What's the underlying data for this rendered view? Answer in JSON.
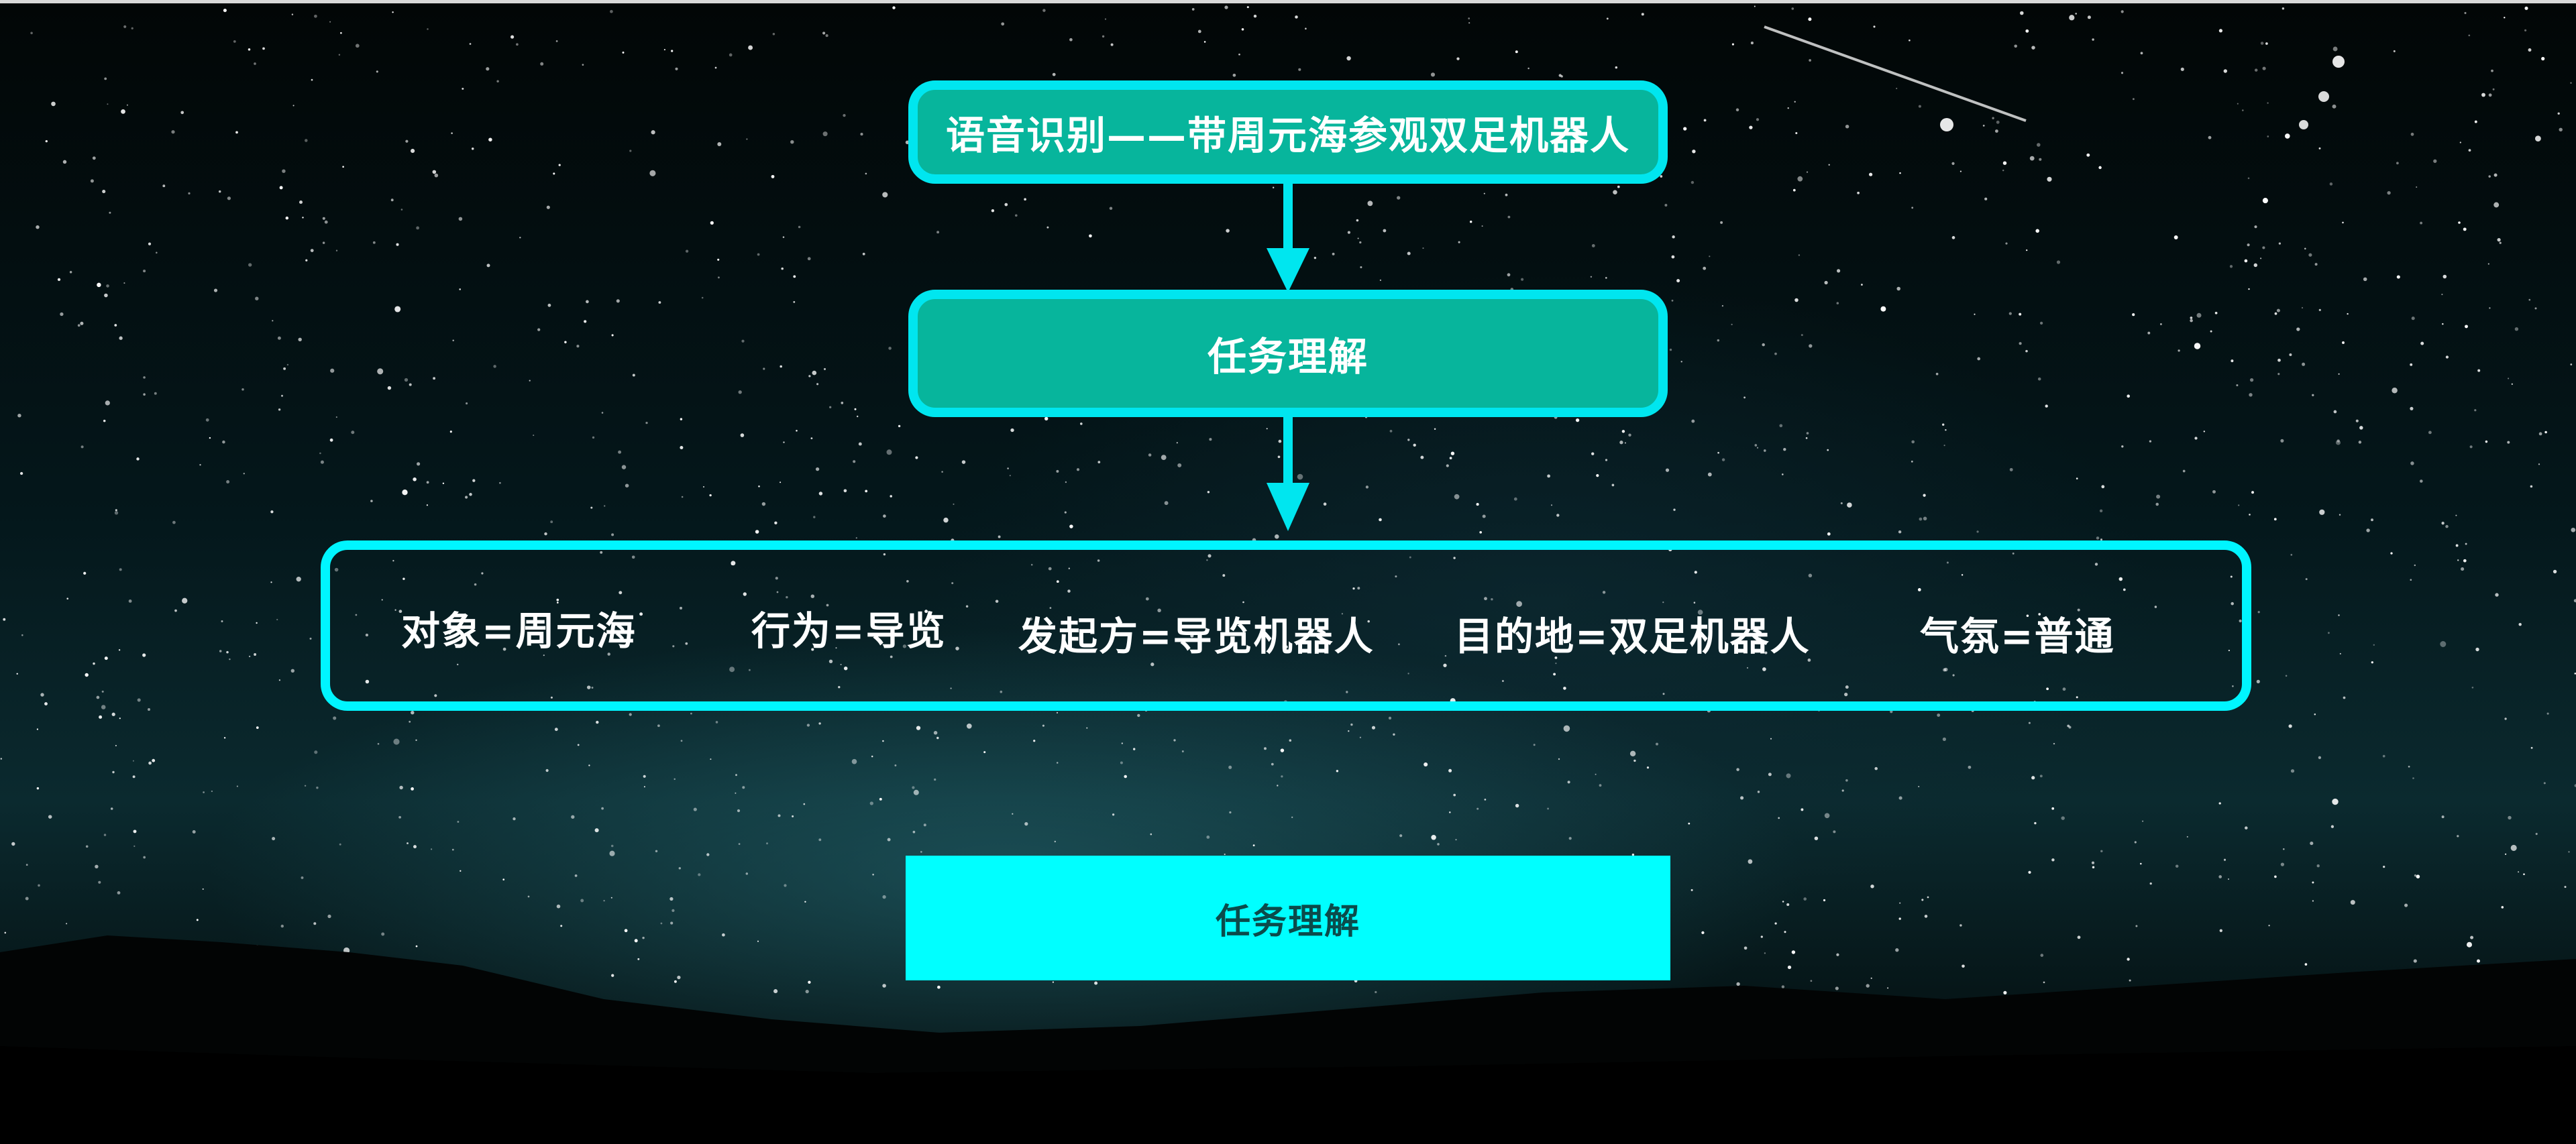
{
  "flow": {
    "speech_box": {
      "label": "语音识别——带周元海参观双足机器人"
    },
    "task_box": {
      "label": "任务理解"
    },
    "slots": [
      {
        "label": "对象=周元海"
      },
      {
        "label": "行为=导览"
      },
      {
        "label": "发起方=导览机器人"
      },
      {
        "label": "目的地=双足机器人"
      },
      {
        "label": "气氛=普通"
      }
    ]
  },
  "action_button": {
    "label": "任务理解"
  },
  "colors": {
    "accent": "#00f5ff",
    "box_fill": "#07b59c",
    "button_fill": "#00ffff",
    "text": "#ffffff",
    "button_text": "#0b4b4b"
  }
}
